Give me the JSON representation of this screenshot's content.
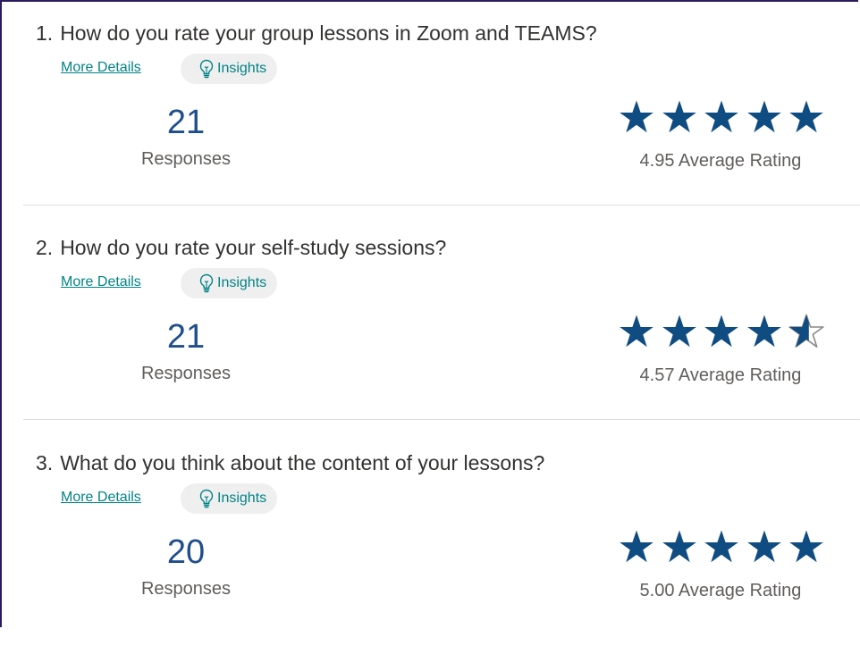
{
  "colors": {
    "accent": "#038387",
    "count_blue": "#1e4e8c",
    "star_blue": "#0f4c81",
    "frame": "#2b1b5c"
  },
  "questions": [
    {
      "number": "1.",
      "title": "How do you rate your group lessons in Zoom and TEAMS?",
      "more_details": "More Details",
      "insights": "Insights",
      "responses": "21",
      "responses_label": "Responses",
      "rating": 4.95,
      "average_text": "4.95 Average Rating",
      "star_icon": "star-icon"
    },
    {
      "number": "2.",
      "title": "How do you rate your self-study sessions?",
      "more_details": "More Details",
      "insights": "Insights",
      "responses": "21",
      "responses_label": "Responses",
      "rating": 4.57,
      "average_text": "4.57 Average Rating",
      "star_icon": "star-icon"
    },
    {
      "number": "3.",
      "title": "What do you think about the content of your lessons?",
      "more_details": "More Details",
      "insights": "Insights",
      "responses": "20",
      "responses_label": "Responses",
      "rating": 5.0,
      "average_text": "5.00 Average Rating",
      "star_icon": "star-icon"
    }
  ],
  "icons": {
    "insights": "lightbulb-icon"
  }
}
